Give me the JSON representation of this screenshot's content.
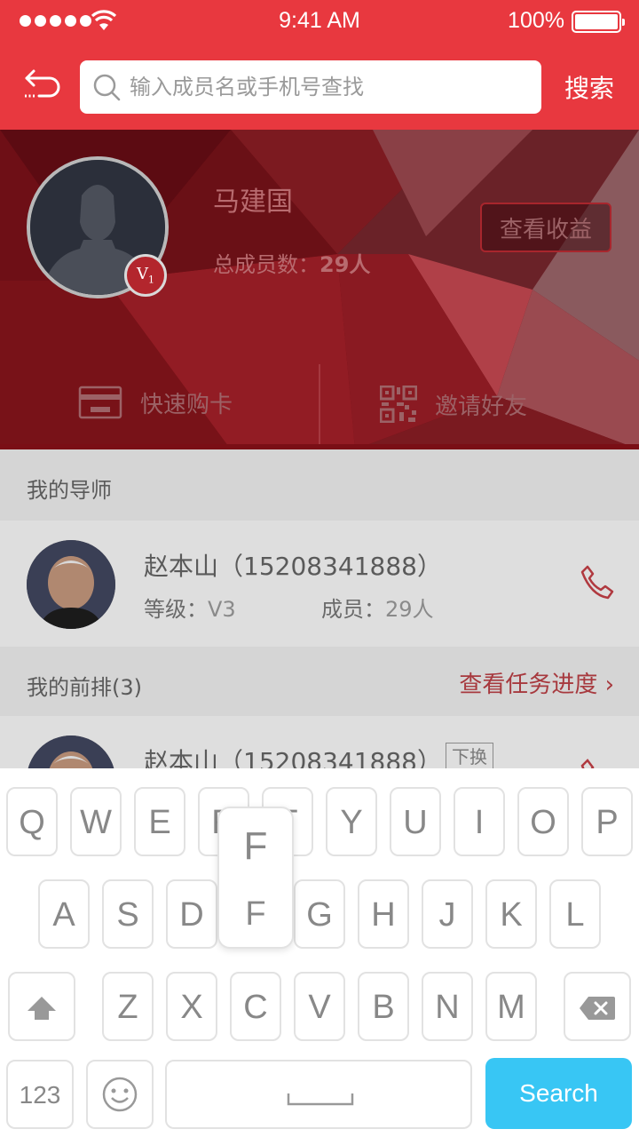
{
  "status_bar": {
    "time": "9:41 AM",
    "battery": "100%"
  },
  "header": {
    "search_placeholder": "输入成员名或手机号查找",
    "search_button": "搜索"
  },
  "profile": {
    "name": "马建国",
    "level_badge": "V",
    "level_sub": "1",
    "total_label": "总成员数：",
    "total_value": "29人",
    "earnings_button": "查看收益",
    "actions": {
      "buy_card": "快速购卡",
      "invite": "邀请好友"
    }
  },
  "mentor_section": {
    "title": "我的导师",
    "member": {
      "name_phone": "赵本山（15208341888）",
      "level_label": "等级：",
      "level": "V3",
      "members_label": "成员：",
      "members": "29人"
    }
  },
  "front_section": {
    "title": "我的前排(3)",
    "link": "查看任务进度",
    "members": [
      {
        "name_phone": "赵本山（15208341888）",
        "tag": "下换"
      }
    ]
  },
  "keyboard": {
    "row1": [
      "Q",
      "W",
      "E",
      "R",
      "T",
      "Y",
      "U",
      "I",
      "O",
      "P"
    ],
    "row2": [
      "A",
      "S",
      "D",
      "F",
      "G",
      "H",
      "J",
      "K",
      "L"
    ],
    "row3": [
      "Z",
      "X",
      "C",
      "V",
      "B",
      "N",
      "M"
    ],
    "popup": "F",
    "numbers": "123",
    "search": "Search"
  }
}
